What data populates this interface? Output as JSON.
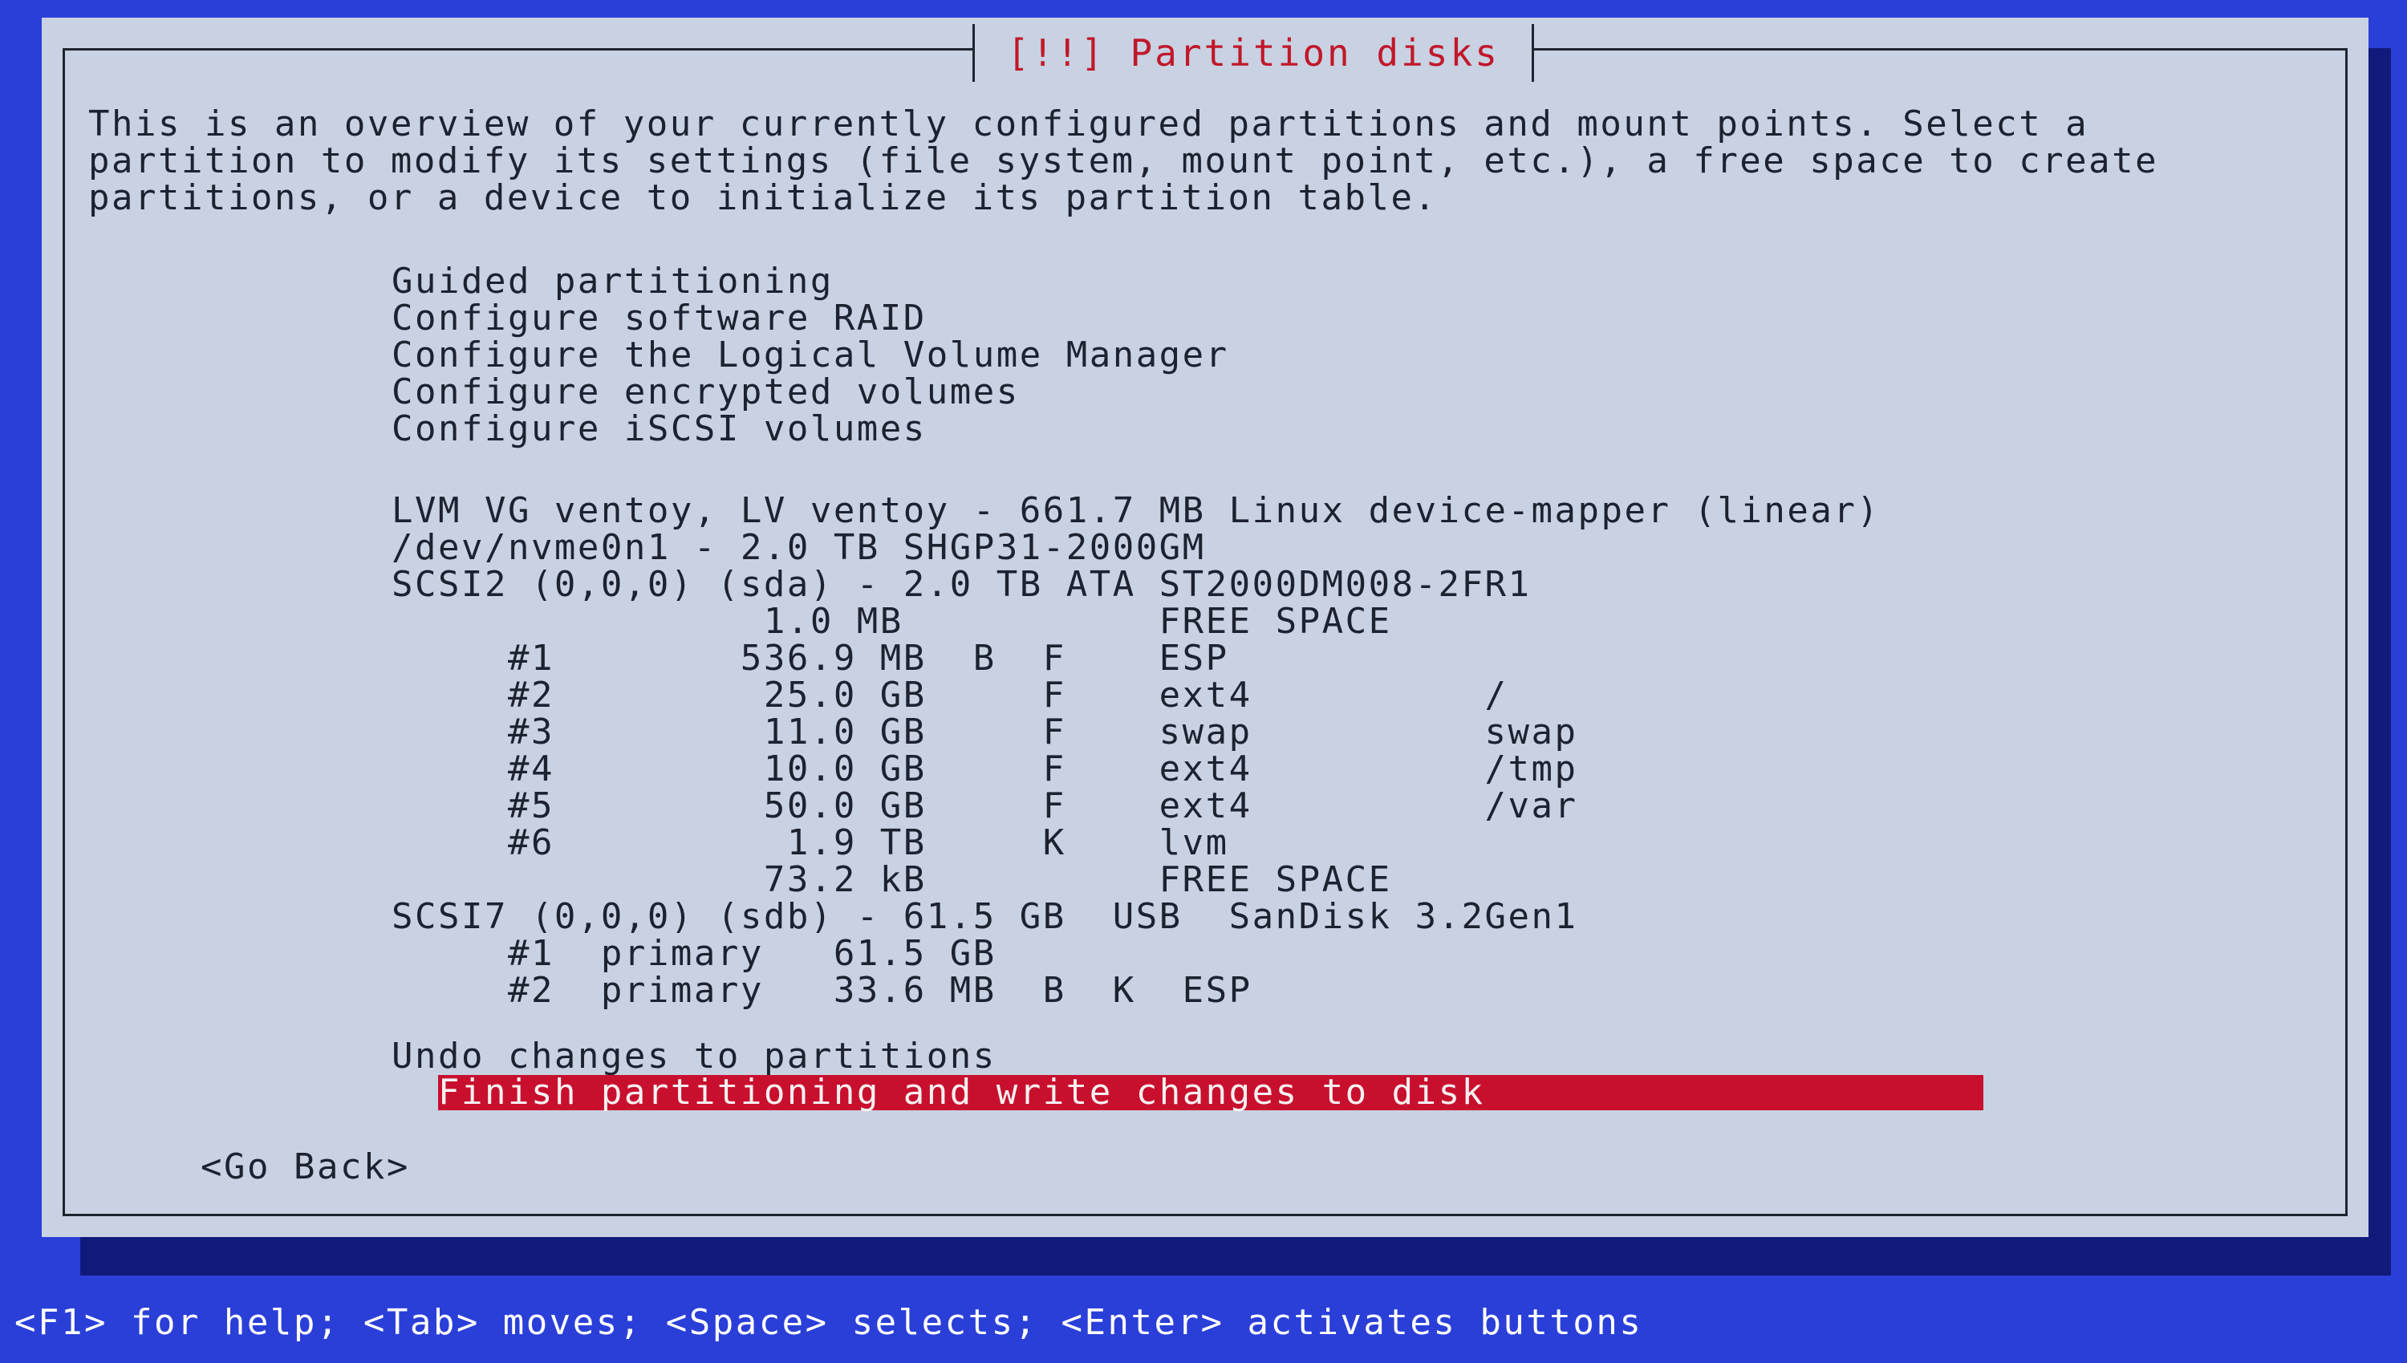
{
  "dialog": {
    "title": "[!!] Partition disks",
    "intro": [
      "This is an overview of your currently configured partitions and mount points. Select a",
      "partition to modify its settings (file system, mount point, etc.), a free space to create",
      "partitions, or a device to initialize its partition table."
    ],
    "menu": [
      "Guided partitioning",
      "Configure software RAID",
      "Configure the Logical Volume Manager",
      "Configure encrypted volumes",
      "Configure iSCSI volumes"
    ],
    "devices": [
      "LVM VG ventoy, LV ventoy - 661.7 MB Linux device-mapper (linear)",
      "/dev/nvme0n1 - 2.0 TB SHGP31-2000GM",
      "SCSI2 (0,0,0) (sda) - 2.0 TB ATA ST2000DM008-2FR1",
      "                1.0 MB           FREE SPACE",
      "     #1        536.9 MB  B  F    ESP",
      "     #2         25.0 GB     F    ext4          /",
      "     #3         11.0 GB     F    swap          swap",
      "     #4         10.0 GB     F    ext4          /tmp",
      "     #5         50.0 GB     F    ext4          /var",
      "     #6          1.9 TB     K    lvm",
      "                73.2 kB          FREE SPACE",
      "SCSI7 (0,0,0) (sdb) - 61.5 GB  USB  SanDisk 3.2Gen1",
      "     #1  primary   61.5 GB",
      "     #2  primary   33.6 MB  B  K  ESP"
    ],
    "undo": "Undo changes to partitions",
    "finish": "Finish partitioning and write changes to disk",
    "go_back": "<Go Back>"
  },
  "status_bar": "<F1> for help; <Tab> moves; <Space> selects; <Enter> activates buttons",
  "colors": {
    "background": "#2a3fd8",
    "dialog": "#c9d2e2",
    "title": "#c0182a",
    "highlight": "#c8102e"
  }
}
